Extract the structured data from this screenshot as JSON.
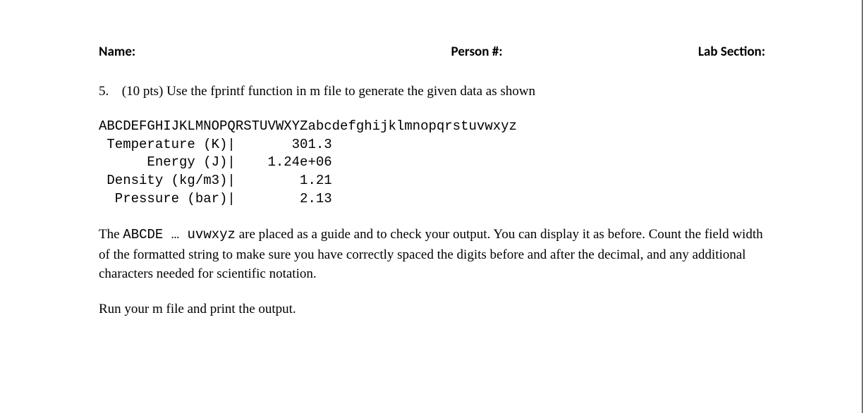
{
  "header": {
    "name_label": "Name:",
    "person_label": "Person #:",
    "lab_label": "Lab Section:"
  },
  "question": {
    "number": "5.",
    "points": "(10 pts)",
    "text": "Use the fprintf function in m file to generate the given data as shown"
  },
  "code": {
    "guide": "ABCDEFGHIJKLMNOPQRSTUVWXYZabcdefghijklmnopqrstuvwxyz",
    "row1": " Temperature (K)|       301.3",
    "row2": "      Energy (J)|    1.24e+06",
    "row3": " Density (kg/m3)|        1.21",
    "row4": "  Pressure (bar)|        2.13"
  },
  "paragraph": {
    "p1a": "The ",
    "p1b": "ABCDE … uvwxyz",
    "p1c": "  are placed as a guide and to check your output. You can display it as before. Count the field width of the formatted string to make sure you have correctly spaced the digits before and after the decimal, and any additional characters needed for scientific notation."
  },
  "closing": "Run your m file and print the output."
}
